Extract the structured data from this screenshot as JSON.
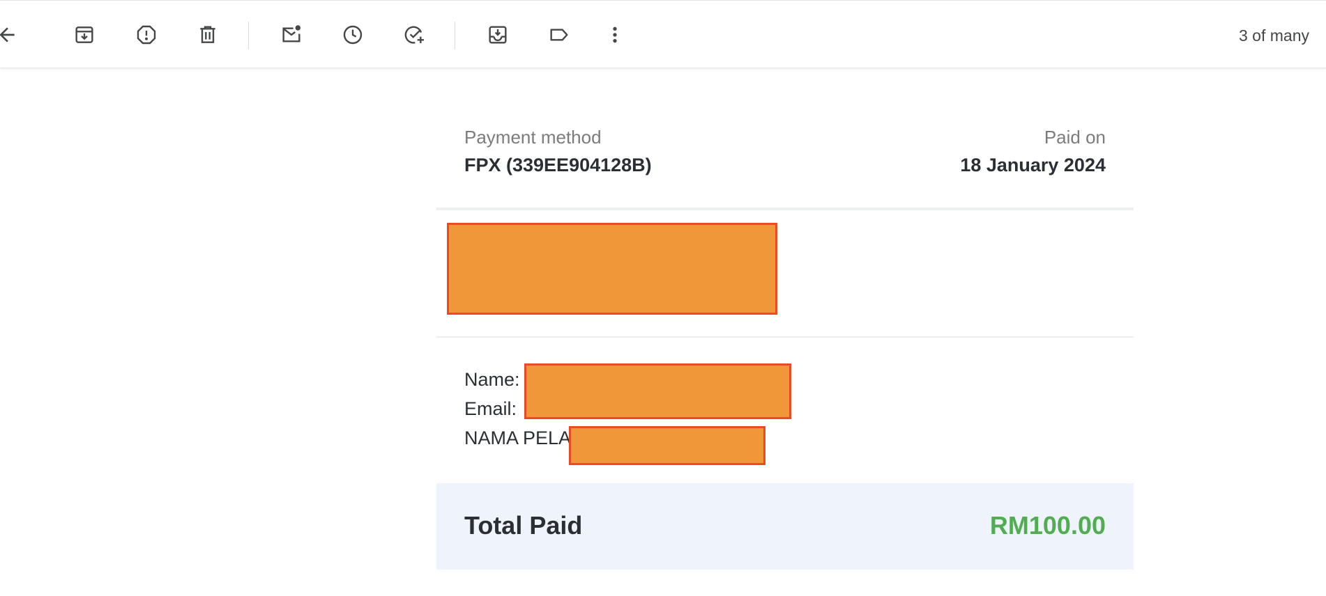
{
  "toolbar": {
    "icons": [
      "back-arrow-icon",
      "archive-icon",
      "report-spam-icon",
      "delete-icon",
      "mark-unread-icon",
      "snooze-icon",
      "add-to-tasks-icon",
      "move-to-icon",
      "label-icon",
      "more-vert-icon"
    ],
    "pager_text": "3 of many"
  },
  "receipt": {
    "payment_method_label": "Payment method",
    "payment_method_value": "FPX (339EE904128B)",
    "paid_on_label": "Paid on",
    "paid_on_value": "18 January 2024",
    "customer": {
      "name_label": "Name:",
      "email_label": "Email:",
      "extra_label": "NAMA PELA"
    },
    "total_label": "Total Paid",
    "total_amount": "RM100.00",
    "colors": {
      "total_amount": "#52ad52",
      "total_background": "#eff4fc",
      "redaction_fill": "#f0973a",
      "redaction_border": "#ec4a22"
    }
  }
}
